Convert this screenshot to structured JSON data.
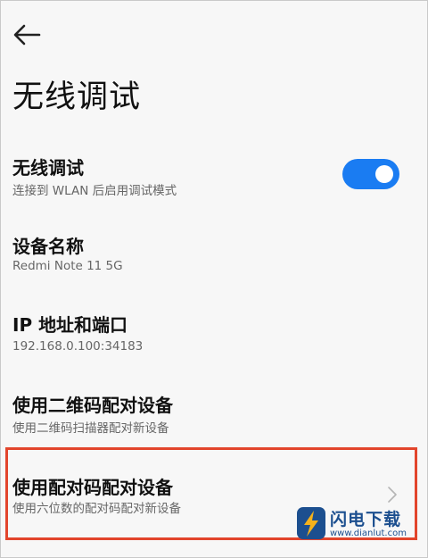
{
  "header": {
    "title": "无线调试"
  },
  "wireless_debugging": {
    "label": "无线调试",
    "description": "连接到 WLAN 后启用调试模式",
    "enabled": true
  },
  "device_name": {
    "label": "设备名称",
    "value": "Redmi Note 11 5G"
  },
  "ip_port": {
    "label": "IP 地址和端口",
    "value": "192.168.0.100:34183"
  },
  "pair_qr": {
    "label": "使用二维码配对设备",
    "description": "使用二维码扫描器配对新设备"
  },
  "pair_code": {
    "label": "使用配对码配对设备",
    "description": "使用六位数的配对码配对新设备"
  },
  "watermark": {
    "name": "闪电下载",
    "url": "www.dianlut.com"
  },
  "colors": {
    "accent": "#1a7cf2",
    "highlight": "#e2452c",
    "watermark": "#1c4f8f"
  }
}
